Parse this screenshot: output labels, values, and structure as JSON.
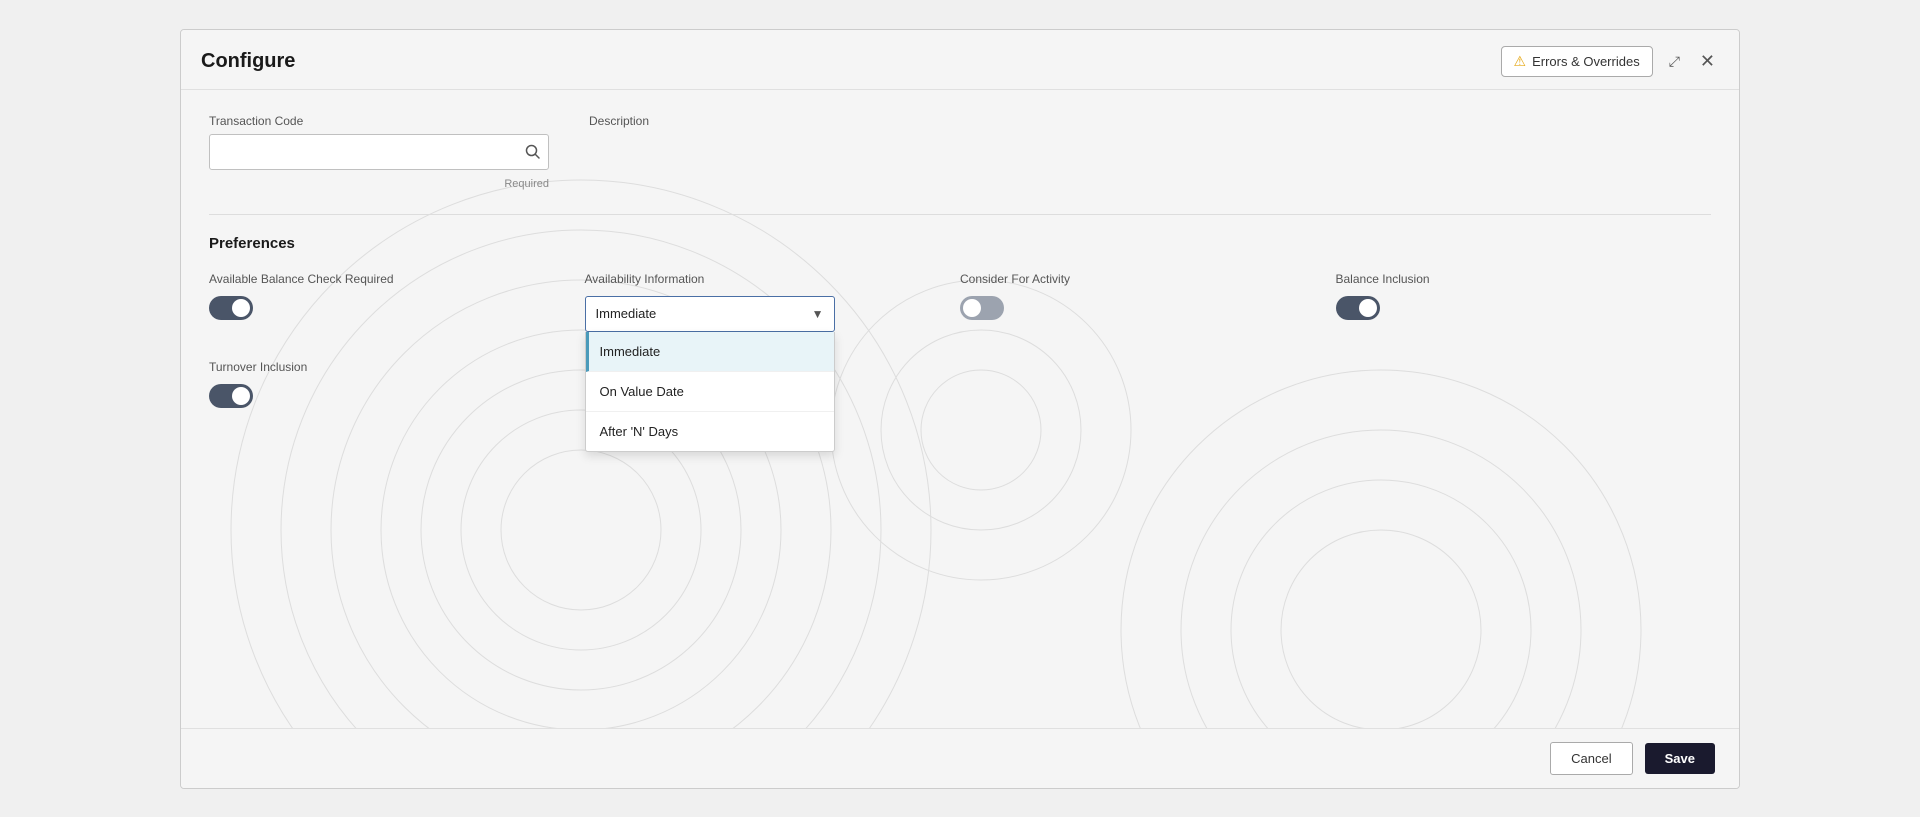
{
  "modal": {
    "title": "Configure"
  },
  "header": {
    "errors_btn": "Errors & Overrides",
    "expand_icon": "⤢",
    "close_icon": "✕"
  },
  "transaction_code": {
    "label": "Transaction Code",
    "placeholder": "",
    "required_text": "Required"
  },
  "description": {
    "label": "Description"
  },
  "preferences": {
    "title": "Preferences",
    "available_balance": {
      "label": "Available Balance Check Required",
      "state": "on"
    },
    "availability_info": {
      "label": "Availability Information",
      "selected": "Immediate",
      "options": [
        {
          "value": "Immediate",
          "label": "Immediate"
        },
        {
          "value": "OnValueDate",
          "label": "On Value Date"
        },
        {
          "value": "AfterNDays",
          "label": "After 'N' Days"
        }
      ]
    },
    "consider_for_activity": {
      "label": "Consider For Activity",
      "state": "off"
    },
    "balance_inclusion": {
      "label": "Balance Inclusion",
      "state": "on"
    },
    "turnover_inclusion": {
      "label": "Turnover Inclusion",
      "state": "on"
    }
  },
  "footer": {
    "cancel_label": "Cancel",
    "save_label": "Save"
  }
}
